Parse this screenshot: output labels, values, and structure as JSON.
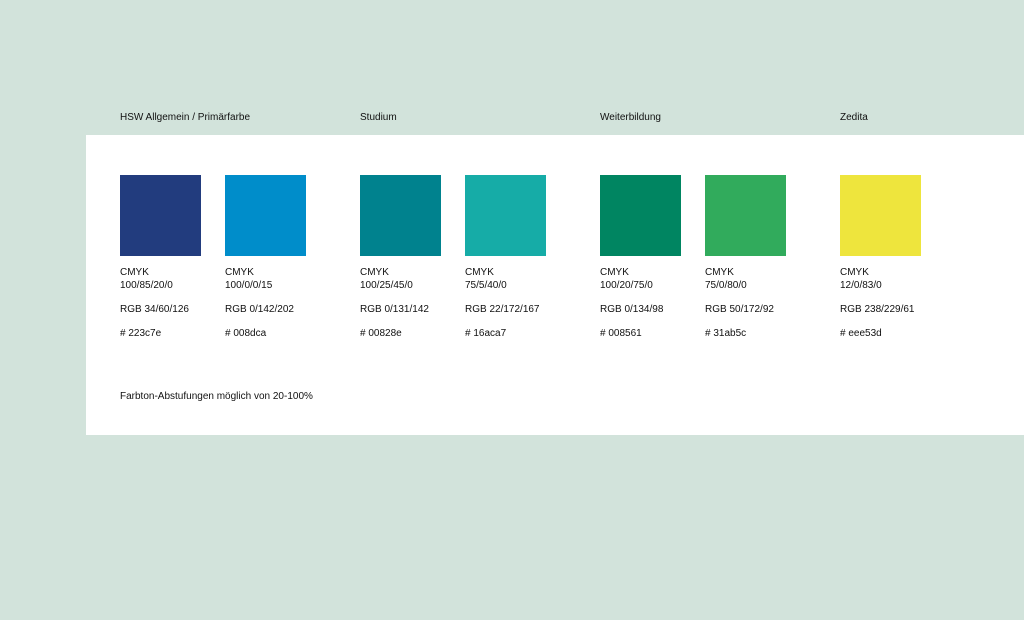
{
  "groups": [
    {
      "title": "HSW Allgemein / Primärfarbe"
    },
    {
      "title": "Studium"
    },
    {
      "title": "Weiterbildung"
    },
    {
      "title": "Zedita"
    }
  ],
  "swatches": [
    {
      "color": "#223c7e",
      "cmyk_label": "CMYK",
      "cmyk": "100/85/20/0",
      "rgb": "RGB 34/60/126",
      "hex": "# 223c7e"
    },
    {
      "color": "#008dca",
      "cmyk_label": "CMYK",
      "cmyk": "100/0/0/15",
      "rgb": "RGB 0/142/202",
      "hex": "# 008dca"
    },
    {
      "color": "#00828e",
      "cmyk_label": "CMYK",
      "cmyk": "100/25/45/0",
      "rgb": "RGB 0/131/142",
      "hex": "# 00828e"
    },
    {
      "color": "#16aca7",
      "cmyk_label": "CMYK",
      "cmyk": "75/5/40/0",
      "rgb": "RGB 22/172/167",
      "hex": "# 16aca7"
    },
    {
      "color": "#008561",
      "cmyk_label": "CMYK",
      "cmyk": "100/20/75/0",
      "rgb": "RGB 0/134/98",
      "hex": "# 008561"
    },
    {
      "color": "#31ab5c",
      "cmyk_label": "CMYK",
      "cmyk": "75/0/80/0",
      "rgb": "RGB 50/172/92",
      "hex": "# 31ab5c"
    },
    {
      "color": "#eee53d",
      "cmyk_label": "CMYK",
      "cmyk": "12/0/83/0",
      "rgb": "RGB 238/229/61",
      "hex": "# eee53d"
    }
  ],
  "footnote": "Farbton-Abstufungen möglich von 20-100%"
}
